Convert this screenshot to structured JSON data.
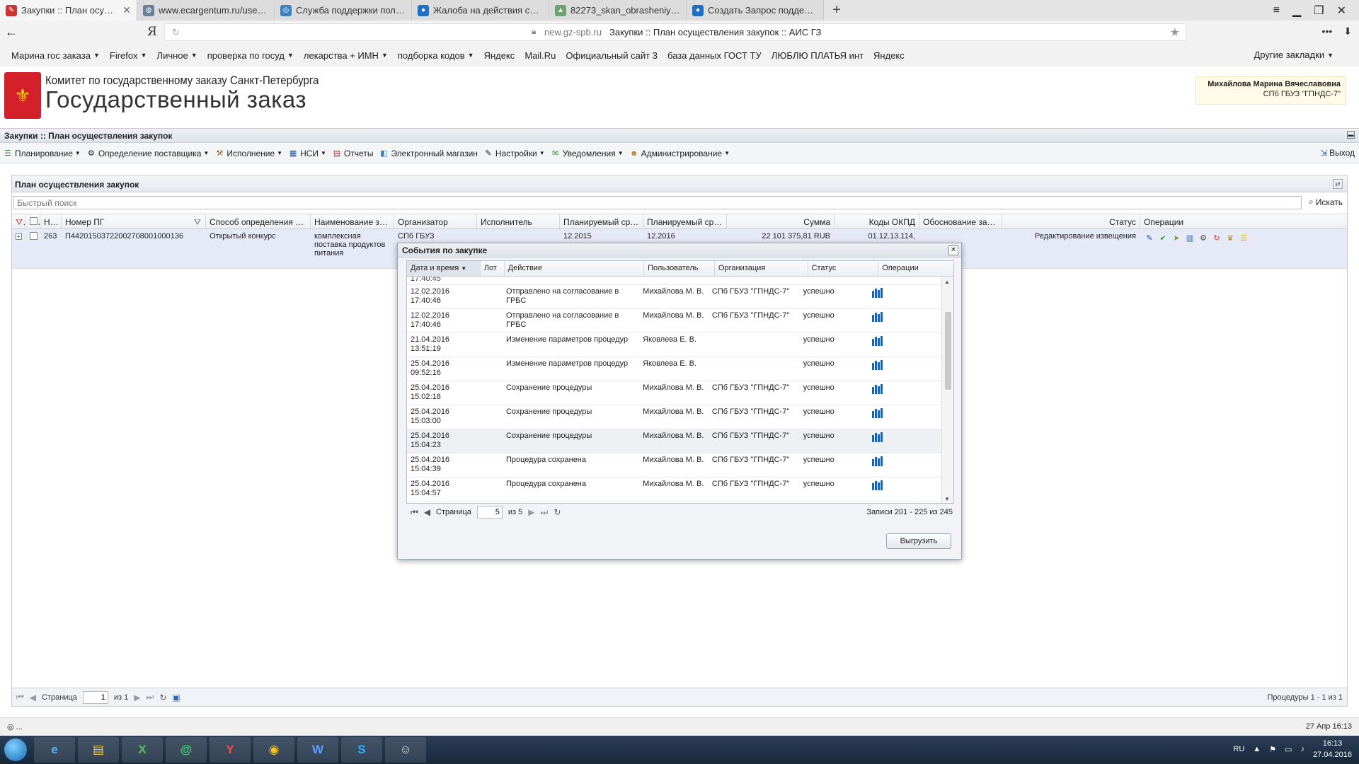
{
  "browser": {
    "tabs": [
      {
        "title": "Закупки :: План осуществле",
        "active": true
      },
      {
        "title": "www.ecargentum.ru/userupl",
        "active": false
      },
      {
        "title": "Служба поддержки пользов",
        "active": false
      },
      {
        "title": "Жалоба на действия сотруд",
        "active": false
      },
      {
        "title": "82273_skan_obrasheniya_13",
        "active": false
      },
      {
        "title": "Создать Запрос поддержки",
        "active": false
      }
    ],
    "new_tab": "+",
    "ya": "Я",
    "address_domain": "new.gz-spb.ru",
    "address_title": "Закупки :: План осуществления закупок :: АИС ГЗ",
    "bookmarks": [
      "Марина гос заказа",
      "Firefox",
      "Личное",
      "проверка по госуд",
      "лекарства + ИМН",
      "подборка кодов",
      "Яндекс",
      "Mail.Ru",
      "Официальный сайт 3",
      "база данных ГОСТ ТУ",
      "ЛЮБЛЮ ПЛАТЬЯ инт",
      "Яндекс"
    ],
    "bookmarks_other": "Другие закладки"
  },
  "header": {
    "org": "Комитет по государственному заказу Санкт-Петербурга",
    "title": "Государственный заказ",
    "user_name": "Михайлова Марина Вячеславовна",
    "user_org": "СПб ГБУЗ \"ГПНДС-7\""
  },
  "app": {
    "title": "Закупки :: План осуществления закупок",
    "menu": [
      "Планирование",
      "Определение поставщика",
      "Исполнение",
      "НСИ",
      "Отчеты",
      "Электронный магазин",
      "Настройки",
      "Уведомления",
      "Администрирование"
    ],
    "exit": "Выход"
  },
  "grid": {
    "title": "План осуществления закупок",
    "search_placeholder": "Быстрый поиск",
    "search_button": "Искать",
    "columns": [
      "Но...",
      "Номер ПГ",
      "Способ определения по...",
      "Наименование зак...",
      "Организатор",
      "Исполнитель",
      "Планируемый сро...",
      "Планируемый сро...",
      "Сумма",
      "Коды ОКПД",
      "Обоснование закл...",
      "Статус",
      "Операции"
    ],
    "row": {
      "num": "263",
      "plan_number": "П44201503722002708001000136",
      "method": "Открытый конкурс",
      "name": "комплексная поставка продуктов питания",
      "organizer": "СПб ГБУЗ",
      "executor": "",
      "start": "12.2015",
      "end": "12.2016",
      "sum": "22 101 375,81 RUB",
      "okpd": "01.12.13.114,",
      "justification": "",
      "status": "Редактирование извещения"
    },
    "pager": {
      "page_label": "Страница",
      "page": "1",
      "of": "из 1",
      "info": "Процедуры 1 - 1 из 1"
    }
  },
  "dialog": {
    "title": "События по закупке",
    "columns": [
      "Дата и время",
      "Лот",
      "Действие",
      "Пользователь",
      "Организация",
      "Статус",
      "Операции"
    ],
    "partial_top": "17:40:45",
    "rows": [
      {
        "date": "12.02.2016",
        "time": "17:40:46",
        "lot": "",
        "action": "Отправлено на согласование в ГРБС",
        "user": "Михайлова М. В.",
        "org": "СПб ГБУЗ \"ГПНДС-7\"",
        "status": "успешно"
      },
      {
        "date": "12.02.2016",
        "time": "17:40:46",
        "lot": "",
        "action": "Отправлено на согласование в ГРБС",
        "user": "Михайлова М. В.",
        "org": "СПб ГБУЗ \"ГПНДС-7\"",
        "status": "успешно"
      },
      {
        "date": "21.04.2016",
        "time": "13:51:19",
        "lot": "",
        "action": "Изменение параметров процедур",
        "user": "Яковлева Е. В.",
        "org": "",
        "status": "успешно"
      },
      {
        "date": "25.04.2016",
        "time": "09:52:16",
        "lot": "",
        "action": "Изменение параметров процедур",
        "user": "Яковлева Е. В.",
        "org": "",
        "status": "успешно"
      },
      {
        "date": "25.04.2016",
        "time": "15:02:18",
        "lot": "",
        "action": "Сохранение процедуры",
        "user": "Михайлова М. В.",
        "org": "СПб ГБУЗ \"ГПНДС-7\"",
        "status": "успешно"
      },
      {
        "date": "25.04.2016",
        "time": "15:03:00",
        "lot": "",
        "action": "Сохранение процедуры",
        "user": "Михайлова М. В.",
        "org": "СПб ГБУЗ \"ГПНДС-7\"",
        "status": "успешно"
      },
      {
        "date": "25.04.2016",
        "time": "15:04:23",
        "lot": "",
        "action": "Сохранение процедуры",
        "user": "Михайлова М. В.",
        "org": "СПб ГБУЗ \"ГПНДС-7\"",
        "status": "успешно"
      },
      {
        "date": "25.04.2016",
        "time": "15:04:39",
        "lot": "",
        "action": "Процедура сохранена",
        "user": "Михайлова М. В.",
        "org": "СПб ГБУЗ \"ГПНДС-7\"",
        "status": "успешно"
      },
      {
        "date": "25.04.2016",
        "time": "15:04:57",
        "lot": "",
        "action": "Процедура сохранена",
        "user": "Михайлова М. В.",
        "org": "СПб ГБУЗ \"ГПНДС-7\"",
        "status": "успешно"
      }
    ],
    "highlighted_row": 6,
    "pager": {
      "page_label": "Страница",
      "page": "5",
      "of": "из 5",
      "info": "Записи 201 - 225 из 245"
    },
    "export": "Выгрузить"
  },
  "status_bar": {
    "left": "...",
    "right": "27 Апр 16:13"
  },
  "taskbar": {
    "lang": "RU",
    "time": "16:13",
    "date": "27.04.2016"
  }
}
